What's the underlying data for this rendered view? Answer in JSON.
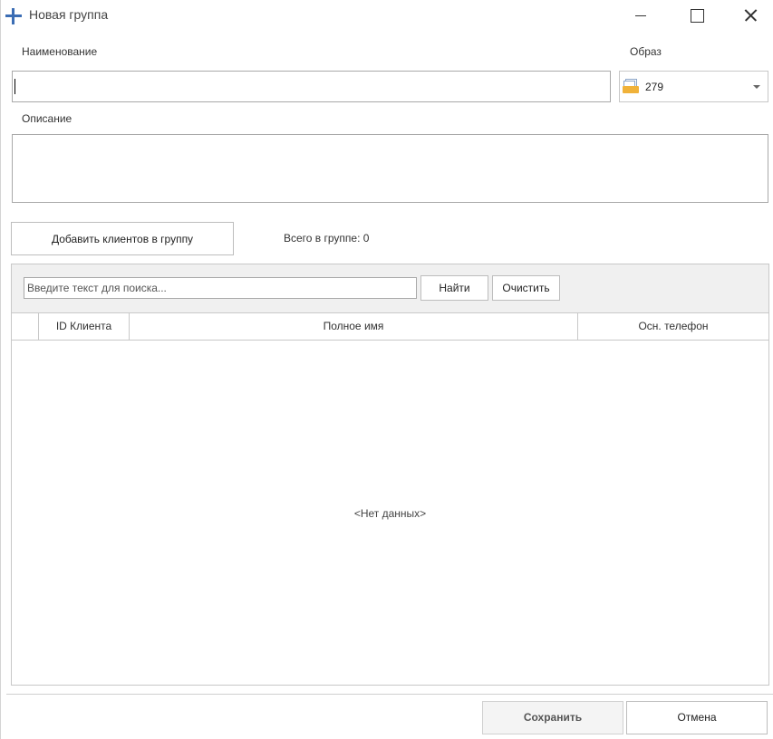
{
  "window": {
    "title": "Новая группа"
  },
  "form": {
    "name_label": "Наименование",
    "name_value": "",
    "image_label": "Образ",
    "image_value": "279",
    "image_icon": "group-image-icon",
    "description_label": "Описание",
    "description_value": ""
  },
  "actions": {
    "add_clients_label": "Добавить клиентов в группу",
    "group_total_label": "Всего в группе: 0"
  },
  "search": {
    "placeholder": "Введите текст для поиска...",
    "find_label": "Найти",
    "clear_label": "Очистить"
  },
  "grid": {
    "columns": [
      "",
      "ID Клиента",
      "Полное имя",
      "Осн. телефон"
    ],
    "rows": [],
    "empty_text": "<Нет данных>"
  },
  "footer": {
    "save_label": "Сохранить",
    "cancel_label": "Отмена"
  },
  "colors": {
    "accent": "#3b6db4",
    "border": "#a9a9a9"
  }
}
